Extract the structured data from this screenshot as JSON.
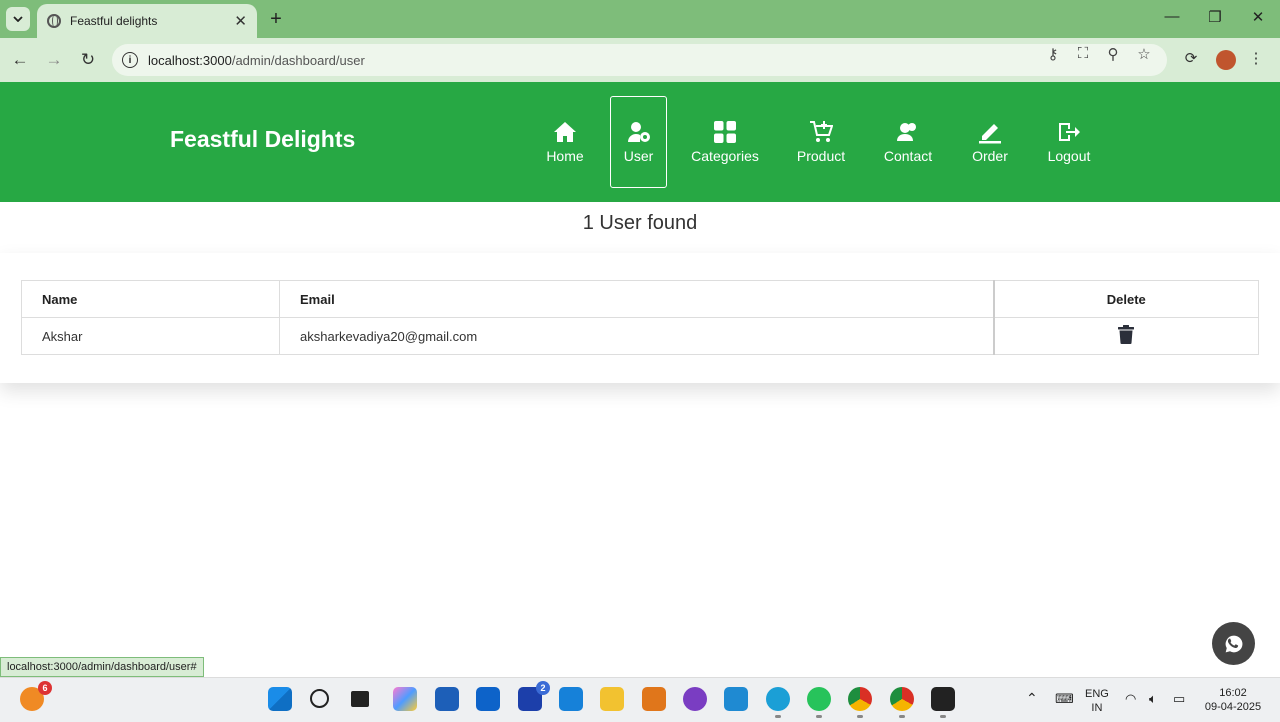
{
  "browser": {
    "tab_title": "Feastful delights",
    "url_host": "localhost:3000",
    "url_path": "/admin/dashboard/user",
    "status_url": "localhost:3000/admin/dashboard/user#"
  },
  "site": {
    "brand": "Feastful Delights",
    "nav": [
      {
        "label": "Home",
        "icon": "home-icon"
      },
      {
        "label": "User",
        "icon": "user-gear-icon",
        "active": true
      },
      {
        "label": "Categories",
        "icon": "grid-icon"
      },
      {
        "label": "Product",
        "icon": "cart-icon"
      },
      {
        "label": "Contact",
        "icon": "contact-icon"
      },
      {
        "label": "Order",
        "icon": "pen-icon"
      },
      {
        "label": "Logout",
        "icon": "logout-icon"
      }
    ]
  },
  "users": {
    "found_text": "1 User found",
    "columns": {
      "name": "Name",
      "email": "Email",
      "delete": "Delete"
    },
    "rows": [
      {
        "name": "Akshar",
        "email": "aksharkevadiya20@gmail.com"
      }
    ]
  },
  "taskbar": {
    "left_badge": "6",
    "l_badge": "2",
    "lang_top": "ENG",
    "lang_bottom": "IN",
    "time": "16:02",
    "date": "09-04-2025"
  }
}
